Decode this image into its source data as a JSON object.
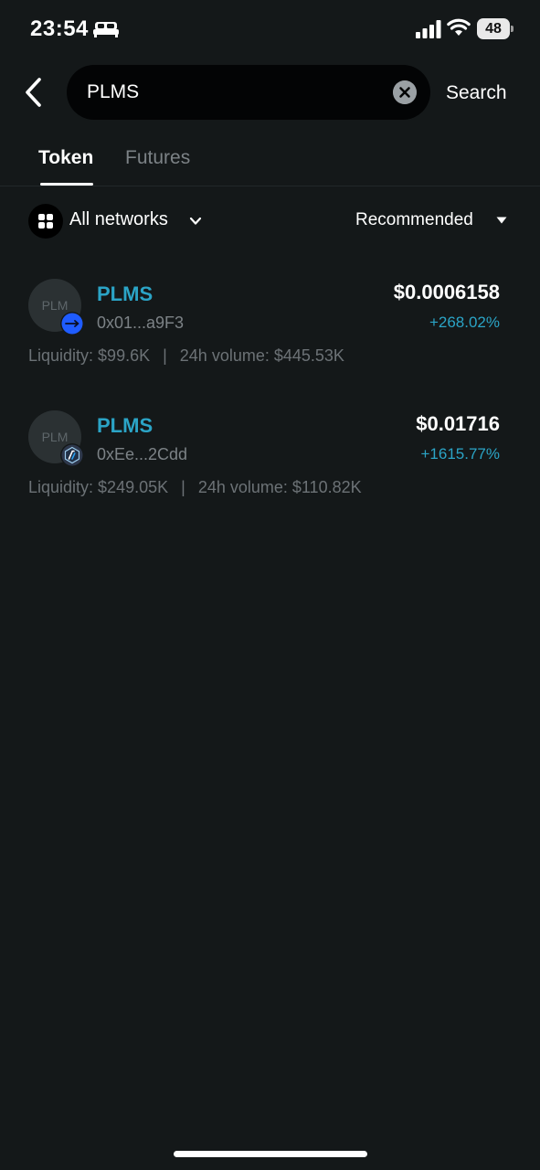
{
  "status_bar": {
    "time": "23:54",
    "battery": "48",
    "icons": [
      "bed-icon",
      "signal-icon",
      "wifi-icon",
      "battery-icon"
    ]
  },
  "header": {
    "back_icon": "chevron-left-icon",
    "search_value": "PLMS",
    "clear_icon": "clear-icon",
    "search_button": "Search"
  },
  "tabs": [
    {
      "label": "Token",
      "active": true
    },
    {
      "label": "Futures",
      "active": false
    }
  ],
  "filters": {
    "network_icon": "grid-icon",
    "network_label": "All networks",
    "sort_label": "Recommended"
  },
  "tokens": [
    {
      "avatar_text": "PLM",
      "chain_icon": "arrow-chain-icon",
      "name": "PLMS",
      "address": "0x01...a9F3",
      "price": "$0.0006158",
      "change": "+268.02%",
      "liquidity": "Liquidity: $99.6K",
      "separator": "|",
      "volume": "24h volume: $445.53K"
    },
    {
      "avatar_text": "PLM",
      "chain_icon": "arbitrum-icon",
      "name": "PLMS",
      "address": "0xEe...2Cdd",
      "price": "$0.01716",
      "change": "+1615.77%",
      "liquidity": "Liquidity: $249.05K",
      "separator": "|",
      "volume": "24h volume: $110.82K"
    }
  ],
  "colors": {
    "background": "#141819",
    "accent": "#2ba4c6",
    "muted": "#7c8286",
    "search_bg": "#030405",
    "chain_blue": "#1f5cff"
  }
}
